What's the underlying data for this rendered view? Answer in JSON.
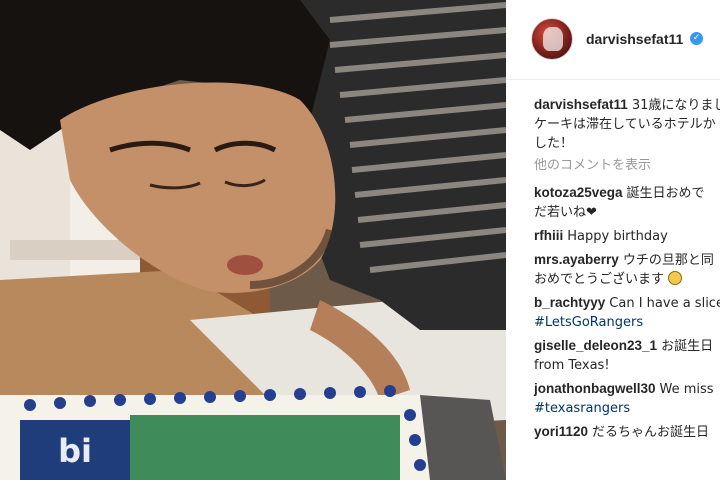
{
  "post": {
    "username": "darvishsefat11",
    "verified_mark": "✓",
    "caption_lines": [
      "31歳になりまし",
      "ケーキは滞在しているホテルか",
      "した！"
    ],
    "view_more": "他のコメントを表示"
  },
  "comments": [
    {
      "user": "kotoza25vega",
      "lines": [
        "誕生日おめで",
        "だ若いね❤"
      ]
    },
    {
      "user": "rfhiii",
      "lines": [
        "Happy birthday"
      ]
    },
    {
      "user": "mrs.ayaberry",
      "lines": [
        "ウチの旦那と同",
        "おめでとうございます"
      ]
    },
    {
      "user": "b_rachtyyy",
      "lines": [
        "Can I have a slice",
        "#LetsGoRangers"
      ]
    },
    {
      "user": "giselle_deleon23_1",
      "lines": [
        "お誕生日",
        "from Texas!"
      ]
    },
    {
      "user": "jonathonbagwell30",
      "lines": [
        "We miss",
        "#texasrangers"
      ]
    },
    {
      "user": "yori1120",
      "lines": [
        "だるちゃんお誕生日"
      ]
    }
  ],
  "colors": {
    "username": "#262626",
    "link": "#003569",
    "muted": "#999999",
    "verified": "#3897f0"
  }
}
